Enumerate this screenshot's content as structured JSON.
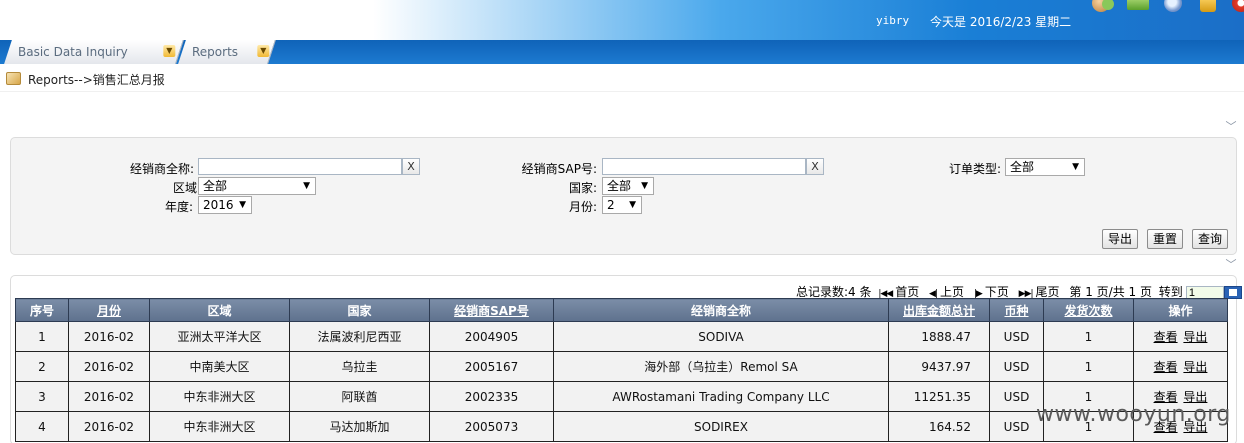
{
  "header": {
    "user": "yibry",
    "date_text": "今天是 2016/2/23 星期二",
    "icons": [
      "message-icon",
      "forward-icon",
      "search-icon",
      "lock-icon",
      "power-icon"
    ]
  },
  "menu": {
    "items": [
      {
        "label": "Basic Data Inquiry"
      },
      {
        "label": "Reports"
      }
    ]
  },
  "breadcrumb": {
    "text": "Reports-->销售汇总月报"
  },
  "filters": {
    "dealer_name_label": "经销商全称:",
    "dealer_name_value": "",
    "dealer_sap_label": "经销商SAP号:",
    "dealer_sap_value": "",
    "order_type_label": "订单类型:",
    "order_type_value": "全部",
    "region_label": "区域:",
    "region_value": "全部",
    "country_label": "国家:",
    "country_value": "全部",
    "year_label": "年度:",
    "year_value": "2016",
    "month_label": "月份:",
    "month_value": "2",
    "clear_glyph": "X"
  },
  "actions": {
    "export": "导出",
    "reset": "重置",
    "query": "查询"
  },
  "pager": {
    "total": "总记录数:4 条",
    "first": "首页",
    "prev": "上页",
    "next": "下页",
    "last": "尾页",
    "page_info": "第 1 页/共 1 页",
    "goto_label": "转到",
    "goto_value": "1"
  },
  "table": {
    "headers": [
      "序号",
      "月份",
      "区域",
      "国家",
      "经销商SAP号",
      "经销商全称",
      "出库金额总计",
      "币种",
      "发货次数",
      "操作"
    ],
    "rows": [
      {
        "no": "1",
        "month": "2016-02",
        "region": "亚洲太平洋大区",
        "country": "法属波利尼西亚",
        "sap": "2004905",
        "name": "SODIVA",
        "amount": "1888.47",
        "currency": "USD",
        "count": "1",
        "view": "查看",
        "export": "导出"
      },
      {
        "no": "2",
        "month": "2016-02",
        "region": "中南美大区",
        "country": "乌拉圭",
        "sap": "2005167",
        "name": "海外部（乌拉圭）Remol SA",
        "amount": "9437.97",
        "currency": "USD",
        "count": "1",
        "view": "查看",
        "export": "导出"
      },
      {
        "no": "3",
        "month": "2016-02",
        "region": "中东非洲大区",
        "country": "阿联酋",
        "sap": "2002335",
        "name": "AWRostamani Trading Company LLC",
        "amount": "11251.35",
        "currency": "USD",
        "count": "1",
        "view": "查看",
        "export": "导出"
      },
      {
        "no": "4",
        "month": "2016-02",
        "region": "中东非洲大区",
        "country": "马达加斯加",
        "sap": "2005073",
        "name": "SODIREX",
        "amount": "164.52",
        "currency": "USD",
        "count": "1",
        "view": "查看",
        "export": "导出"
      }
    ]
  },
  "watermark": "www.wooyun.org"
}
